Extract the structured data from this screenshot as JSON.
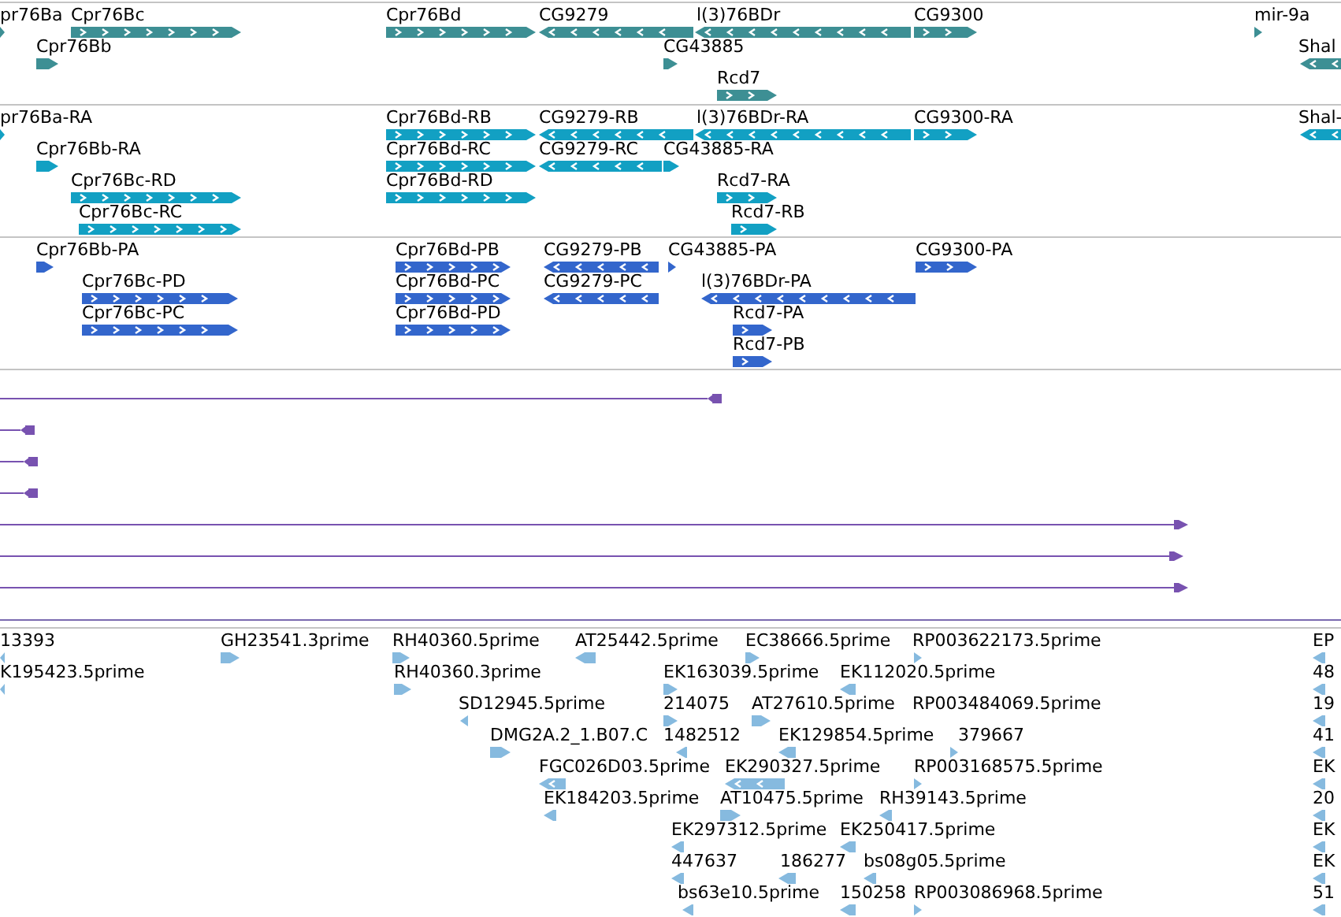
{
  "tracks": [
    {
      "kind": "features",
      "color": "#3d8f94",
      "features": [
        {
          "label": "pr76Ba",
          "reverse": false
        },
        {
          "label": "Cpr76Bc",
          "reverse": false
        },
        {
          "label": "Cpr76Bd",
          "reverse": false
        },
        {
          "label": "CG9279",
          "reverse": true
        },
        {
          "label": "l(3)76BDr",
          "reverse": true
        },
        {
          "label": "CG9300",
          "reverse": false
        },
        {
          "label": "mir-9a",
          "reverse": false
        },
        {
          "label": "Cpr76Bb",
          "reverse": false
        },
        {
          "label": "CG43885",
          "reverse": false
        },
        {
          "label": "Shal",
          "reverse": true
        },
        {
          "label": "Rcd7",
          "reverse": false
        }
      ]
    },
    {
      "kind": "features",
      "color": "#12a0c3",
      "features": [
        {
          "label": "pr76Ba-RA",
          "reverse": false
        },
        {
          "label": "Cpr76Bd-RB",
          "reverse": false
        },
        {
          "label": "CG9279-RB",
          "reverse": true
        },
        {
          "label": "l(3)76BDr-RA",
          "reverse": true
        },
        {
          "label": "CG9300-RA",
          "reverse": false
        },
        {
          "label": "Shal-",
          "reverse": true
        },
        {
          "label": "Cpr76Bb-RA",
          "reverse": false
        },
        {
          "label": "Cpr76Bd-RC",
          "reverse": false
        },
        {
          "label": "CG9279-RC",
          "reverse": true
        },
        {
          "label": "CG43885-RA",
          "reverse": false
        },
        {
          "label": "Cpr76Bc-RD",
          "reverse": false
        },
        {
          "label": "Cpr76Bd-RD",
          "reverse": false
        },
        {
          "label": "Rcd7-RA",
          "reverse": false
        },
        {
          "label": "Cpr76Bc-RC",
          "reverse": false
        },
        {
          "label": "Rcd7-RB",
          "reverse": false
        }
      ]
    },
    {
      "kind": "features",
      "color": "#3366cc",
      "features": [
        {
          "label": "Cpr76Bb-PA",
          "reverse": false
        },
        {
          "label": "Cpr76Bd-PB",
          "reverse": false
        },
        {
          "label": "CG9279-PB",
          "reverse": true
        },
        {
          "label": "CG43885-PA",
          "reverse": false
        },
        {
          "label": "CG9300-PA",
          "reverse": false
        },
        {
          "label": "Cpr76Bc-PD",
          "reverse": false
        },
        {
          "label": "Cpr76Bd-PC",
          "reverse": false
        },
        {
          "label": "CG9279-PC",
          "reverse": true
        },
        {
          "label": "l(3)76BDr-PA",
          "reverse": true
        },
        {
          "label": "Cpr76Bc-PC",
          "reverse": false
        },
        {
          "label": "Cpr76Bd-PD",
          "reverse": false
        },
        {
          "label": "Rcd7-PA",
          "reverse": false
        },
        {
          "label": "Rcd7-PB",
          "reverse": false
        }
      ]
    },
    {
      "kind": "alignments",
      "color": "#7852b0",
      "features": [
        {
          "reverse": true
        },
        {
          "reverse": true
        },
        {
          "reverse": true
        },
        {
          "reverse": true
        },
        {
          "reverse": false
        },
        {
          "reverse": false
        },
        {
          "reverse": false
        }
      ]
    },
    {
      "kind": "features",
      "color": "#86badf",
      "features": [
        {
          "label": "13393",
          "reverse": true
        },
        {
          "label": "GH23541.3prime",
          "reverse": false
        },
        {
          "label": "RH40360.5prime",
          "reverse": false
        },
        {
          "label": "AT25442.5prime",
          "reverse": true
        },
        {
          "label": "EC38666.5prime",
          "reverse": false
        },
        {
          "label": "RP003622173.5prime",
          "reverse": false
        },
        {
          "label": "EP",
          "reverse": true
        },
        {
          "label": "K195423.5prime",
          "reverse": true
        },
        {
          "label": "RH40360.3prime",
          "reverse": false
        },
        {
          "label": "EK163039.5prime",
          "reverse": false
        },
        {
          "label": "EK112020.5prime",
          "reverse": true
        },
        {
          "label": "48",
          "reverse": true
        },
        {
          "label": "SD12945.5prime",
          "reverse": true
        },
        {
          "label": "214075",
          "reverse": false
        },
        {
          "label": "AT27610.5prime",
          "reverse": false
        },
        {
          "label": "RP003484069.5prime"
        },
        {
          "label": "19",
          "reverse": true
        },
        {
          "label": "DMG2A.2_1.B07.C",
          "reverse": false
        },
        {
          "label": "1482512",
          "reverse": true
        },
        {
          "label": "EK129854.5prime",
          "reverse": true
        },
        {
          "label": "379667",
          "reverse": false
        },
        {
          "label": "41",
          "reverse": true
        },
        {
          "label": "FGC026D03.5prime",
          "reverse": true
        },
        {
          "label": "EK290327.5prime",
          "reverse": true
        },
        {
          "label": "RP003168575.5prime",
          "reverse": false
        },
        {
          "label": "EK",
          "reverse": true
        },
        {
          "label": "EK184203.5prime",
          "reverse": true
        },
        {
          "label": "AT10475.5prime",
          "reverse": false
        },
        {
          "label": "RH39143.5prime",
          "reverse": true
        },
        {
          "label": "20",
          "reverse": true
        },
        {
          "label": "EK297312.5prime",
          "reverse": true
        },
        {
          "label": "EK250417.5prime",
          "reverse": true
        },
        {
          "label": "EK",
          "reverse": true
        },
        {
          "label": "447637",
          "reverse": true
        },
        {
          "label": "186277",
          "reverse": true
        },
        {
          "label": "bs08g05.5prime",
          "reverse": true
        },
        {
          "label": "EK",
          "reverse": true
        },
        {
          "label": "bs63e10.5prime",
          "reverse": true
        },
        {
          "label": "150258",
          "reverse": true
        },
        {
          "label": "RP003086968.5prime",
          "reverse": false
        },
        {
          "label": "51",
          "reverse": true
        }
      ]
    }
  ]
}
